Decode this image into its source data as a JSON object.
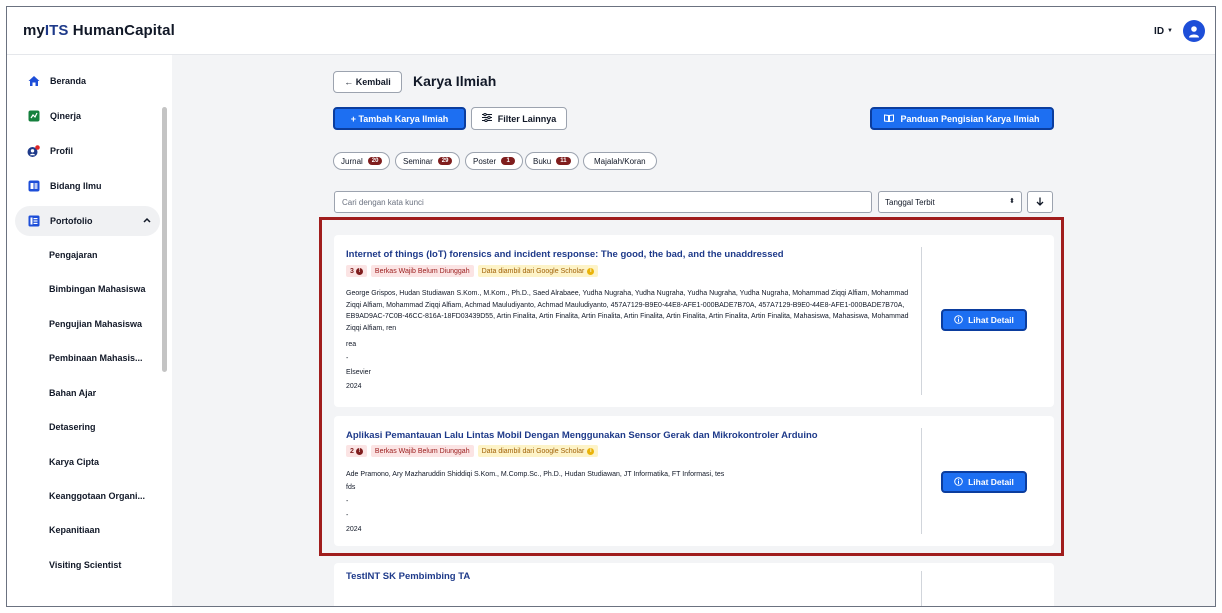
{
  "app": {
    "brand_prefix": "my",
    "brand_its": "ITS",
    "brand_suffix": " HumanCapital",
    "language": "ID"
  },
  "sidebar": {
    "items": [
      {
        "label": "Beranda",
        "icon": "home-icon"
      },
      {
        "label": "Qinerja",
        "icon": "qinerja-icon"
      },
      {
        "label": "Profil",
        "icon": "profile-icon"
      },
      {
        "label": "Bidang Ilmu",
        "icon": "bidang-ilmu-icon"
      },
      {
        "label": "Portofolio",
        "icon": "portfolio-icon"
      }
    ],
    "sub_items": [
      "Pengajaran",
      "Bimbingan Mahasiswa",
      "Pengujian Mahasiswa",
      "Pembinaan Mahasis...",
      "Bahan Ajar",
      "Detasering",
      "Karya Cipta",
      "Keanggotaan Organi...",
      "Kepanitiaan",
      "Visiting Scientist"
    ]
  },
  "header": {
    "back_label": "← Kembali",
    "title": "Karya Ilmiah"
  },
  "toolbar": {
    "add_label": "+   Tambah Karya Ilmiah",
    "filter_label": "Filter Lainnya",
    "guide_label": "Panduan Pengisian Karya Ilmiah"
  },
  "categories": [
    {
      "label": "Jurnal",
      "count": "20"
    },
    {
      "label": "Seminar",
      "count": "29"
    },
    {
      "label": "Poster",
      "count": "1"
    },
    {
      "label": "Buku",
      "count": "11"
    },
    {
      "label": "Majalah/Koran",
      "count": ""
    }
  ],
  "search": {
    "placeholder": "Cari dengan kata kunci"
  },
  "sort": {
    "selected": "Tanggal Terbit"
  },
  "cards": [
    {
      "title": "Internet of things (IoT) forensics and incident response: The good, the bad, and the unaddressed",
      "file_count": "3",
      "status": "Berkas Wajib Belum Diunggah",
      "source": "Data diambil dari Google Scholar",
      "authors": "George Grispos, Hudan Studiawan S.Kom., M.Kom., Ph.D., Saed Alrabaee, Yudha Nugraha, Yudha Nugraha, Yudha Nugraha, Yudha Nugraha, Mohammad Ziqqi Alfiam, Mohammad Ziqqi Alfiam, Mohammad Ziqqi Alfiam, Achmad Mauludiyanto, Achmad Mauludiyanto, 457A7129-B9E0-44E8-AFE1-000BADE7B70A, 457A7129-B9E0-44E8-AFE1-000BADE7B70A, EB9AD9AC-7C0B-46CC-816A-18FD03439D55, Artin Finalita, Artin Finalita, Artin Finalita, Artin Finalita, Artin Finalita, Artin Finalita, Artin Finalita, Mahasiswa, Mahasiswa, Mohammad Ziqqi Alfiam, ren",
      "line1": "rea",
      "line2": "-",
      "publisher": "Elsevier",
      "year": "2024",
      "detail_label": "Lihat Detail"
    },
    {
      "title": "Aplikasi Pemantauan Lalu Lintas Mobil Dengan Menggunakan Sensor Gerak dan Mikrokontroler Arduino",
      "file_count": "2",
      "status": "Berkas Wajib Belum Diunggah",
      "source": "Data diambil dari Google Scholar",
      "authors": "Ade Pramono, Ary Mazharuddin Shiddiqi S.Kom., M.Comp.Sc., Ph.D., Hudan Studiawan, JT Informatika, FT Informasi, tes",
      "line1": "fds",
      "line2": "-",
      "publisher": "-",
      "year": "2024",
      "detail_label": "Lihat Detail"
    },
    {
      "title": "TestINT SK Pembimbing TA"
    }
  ],
  "colors": {
    "primary": "#1d6ff2",
    "highlight": "#a01d1d",
    "badge_dark": "#7f1d1d",
    "title_blue": "#1e3a8a"
  }
}
